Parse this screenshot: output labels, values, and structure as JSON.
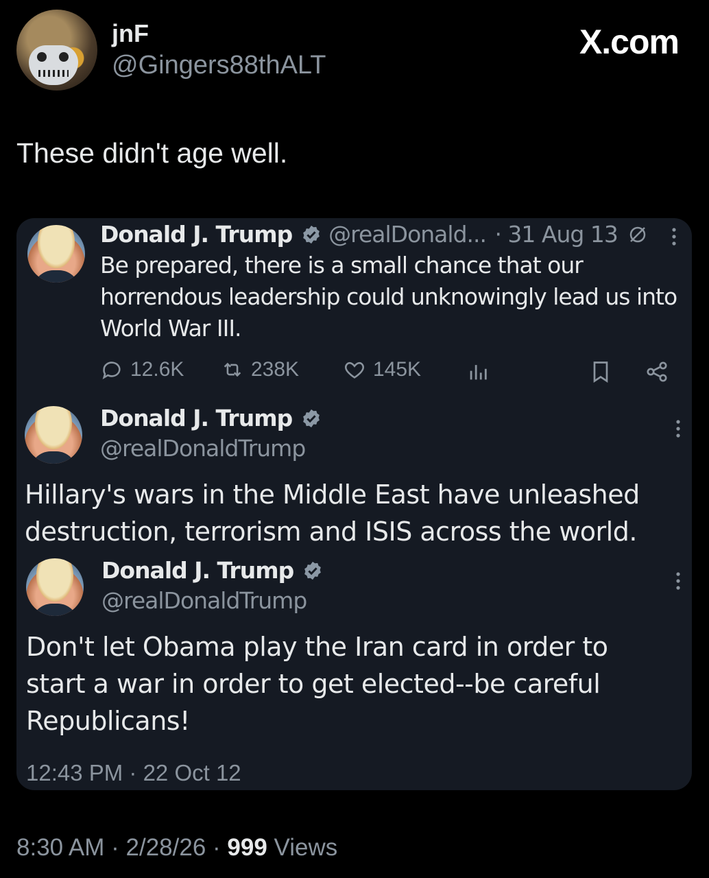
{
  "header": {
    "display_name": "jnF",
    "handle": "@Gingers88thALT",
    "brand": "X.com"
  },
  "tweet": {
    "text": "These didn't age well."
  },
  "card": {
    "quote1": {
      "name": "Donald J. Trump",
      "handle": "@realDonald...",
      "date": "· 31 Aug 13",
      "body": [
        "Be prepared, there is a small chance that our",
        "horrendous leadership could unknowingly lead us into",
        "World War III."
      ],
      "replies": "12.6K",
      "reposts": "238K",
      "likes": "145K"
    },
    "quote2": {
      "name": "Donald J. Trump",
      "handle": "@realDonaldTrump",
      "body": [
        "Hillary's wars in the Middle East have unleashed",
        "destruction, terrorism and ISIS across the world."
      ]
    },
    "quote3": {
      "name": "Donald J. Trump",
      "handle": "@realDonaldTrump",
      "body": [
        "Don't let Obama play the Iran card in order to",
        "start a war in order to get elected--be careful",
        "Republicans!"
      ]
    },
    "timestamp": "12:43 PM · 22 Oct 12"
  },
  "footer": {
    "time": "8:30 AM · 2/28/26 · ",
    "views_count": "999",
    "views_label": " Views"
  },
  "colors": {
    "background": "#000000",
    "card": "#151a23",
    "text": "#e7e9ea",
    "muted": "#8b949e",
    "verified": "#8b98a5"
  }
}
